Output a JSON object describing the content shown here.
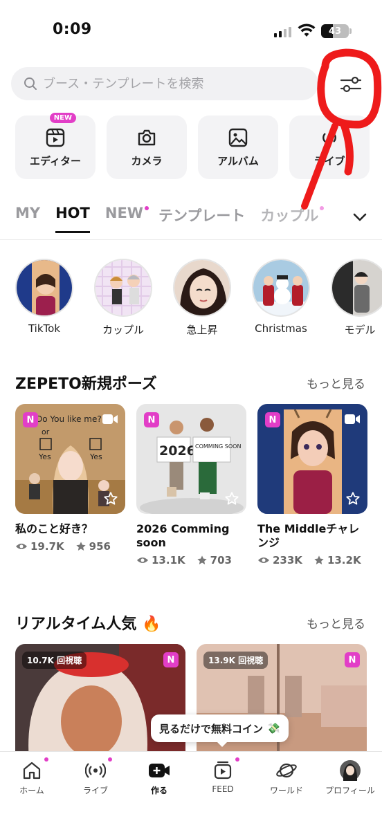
{
  "status_bar": {
    "time": "0:09",
    "battery": "43",
    "battery_level": 0.43
  },
  "search": {
    "placeholder": "ブース・テンプレートを検索"
  },
  "quick_actions": [
    {
      "label": "エディター",
      "badge": "NEW",
      "icon": "video-editor-icon"
    },
    {
      "label": "カメラ",
      "icon": "camera-icon"
    },
    {
      "label": "アルバム",
      "icon": "image-icon"
    },
    {
      "label": "ライブ",
      "icon": "live-icon"
    }
  ],
  "tabs": [
    {
      "label": "MY",
      "active": false,
      "dot": false
    },
    {
      "label": "HOT",
      "active": true,
      "dot": false
    },
    {
      "label": "NEW",
      "active": false,
      "dot": true
    },
    {
      "label": "テンプレート",
      "active": false,
      "dot": false
    },
    {
      "label": "カップル",
      "active": false,
      "dot": true
    }
  ],
  "categories": [
    {
      "label": "TikTok"
    },
    {
      "label": "カップル"
    },
    {
      "label": "急上昇"
    },
    {
      "label": "Christmas"
    },
    {
      "label": "モデル"
    }
  ],
  "poses_section": {
    "title": "ZEPETO新規ポーズ",
    "more": "もっと見る",
    "items": [
      {
        "badge": "N",
        "title": "私のこと好き？",
        "views": "19.7K",
        "stars": "956",
        "thumb_text_1": "Do You like me?",
        "thumb_text_2": "or",
        "thumb_text_3": "Yes",
        "thumb_text_4": "Yes"
      },
      {
        "badge": "N",
        "title": "2026 Comming soon",
        "views": "13.1K",
        "stars": "703",
        "thumb_text_1": "2026",
        "thumb_text_2": "COMMING SOON"
      },
      {
        "badge": "N",
        "title": "The Middleチャレンジ",
        "views": "233K",
        "stars": "13.2K"
      }
    ]
  },
  "live_section": {
    "title": "リアルタイム人気",
    "emoji": "🔥",
    "more": "もっと見る",
    "items": [
      {
        "views": "10.7K 回視聴",
        "badge": "N"
      },
      {
        "views": "13.9K 回視聴",
        "badge": "N"
      }
    ]
  },
  "toast": {
    "text": "見るだけで無料コイン",
    "emoji": "💸"
  },
  "bottom_nav": [
    {
      "label": "ホーム",
      "icon": "home-icon",
      "dot": true
    },
    {
      "label": "ライブ",
      "icon": "live-icon",
      "dot": true
    },
    {
      "label": "作る",
      "icon": "create-icon",
      "dot": false
    },
    {
      "label": "FEED",
      "icon": "feed-icon",
      "dot": true
    },
    {
      "label": "ワールド",
      "icon": "world-icon",
      "dot": false
    },
    {
      "label": "プロフィール",
      "icon": "avatar",
      "dot": false
    }
  ],
  "colors": {
    "accent": "#e23ec7",
    "annotation": "#ee1b1b"
  }
}
